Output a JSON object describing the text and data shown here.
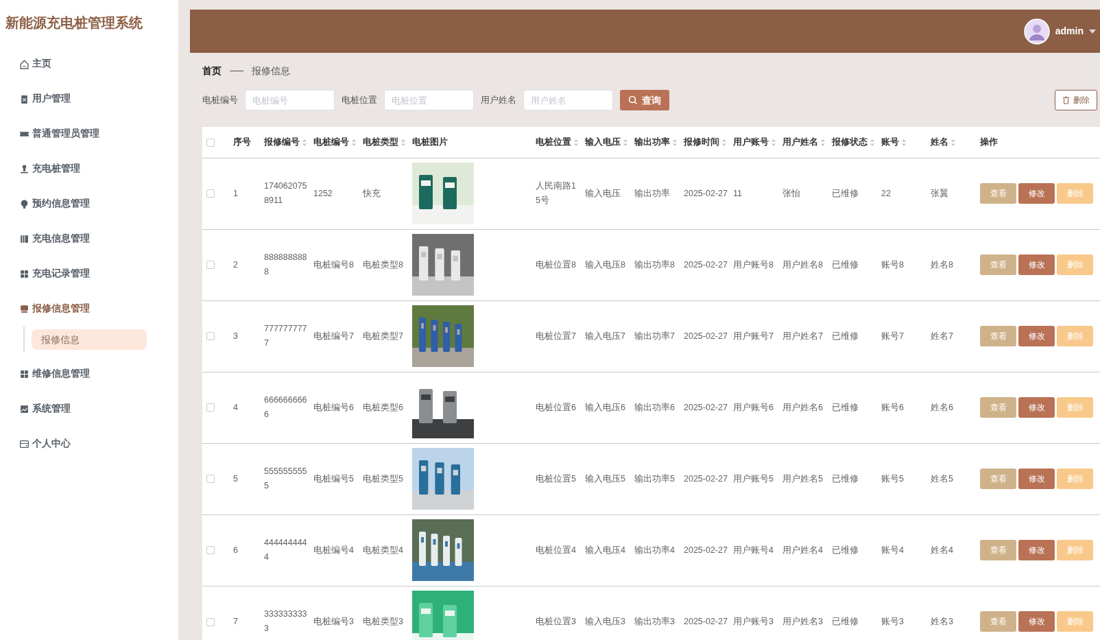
{
  "sidebar": {
    "title": "新能源充电桩管理系统",
    "items": [
      {
        "label": "主页",
        "selected": false
      },
      {
        "label": "用户管理",
        "selected": false
      },
      {
        "label": "普通管理员管理",
        "selected": false
      },
      {
        "label": "充电桩管理",
        "selected": false
      },
      {
        "label": "预约信息管理",
        "selected": false
      },
      {
        "label": "充电信息管理",
        "selected": false
      },
      {
        "label": "充电记录管理",
        "selected": false
      },
      {
        "label": "报修信息管理",
        "selected": true,
        "children": [
          {
            "label": "报修信息",
            "selected": true
          }
        ]
      },
      {
        "label": "维修信息管理",
        "selected": false
      },
      {
        "label": "系统管理",
        "selected": false
      },
      {
        "label": "个人中心",
        "selected": false
      }
    ]
  },
  "header": {
    "user": "admin"
  },
  "breadcrumb": [
    "首页",
    "报修信息"
  ],
  "search": {
    "fields": [
      {
        "label": "电桩编号",
        "placeholder": "电桩编号"
      },
      {
        "label": "电桩位置",
        "placeholder": "电桩位置"
      },
      {
        "label": "用户姓名",
        "placeholder": "用户姓名"
      }
    ],
    "button": "查询",
    "delete_button": "删除"
  },
  "table": {
    "header_checked": false,
    "columns": [
      {
        "label": "序号",
        "sortable": false
      },
      {
        "label": "报修编号",
        "sortable": true
      },
      {
        "label": "电桩编号",
        "sortable": true
      },
      {
        "label": "电桩类型",
        "sortable": true
      },
      {
        "label": "电桩图片",
        "sortable": false
      },
      {
        "label": "电桩位置",
        "sortable": true
      },
      {
        "label": "输入电压",
        "sortable": true
      },
      {
        "label": "输出功率",
        "sortable": true
      },
      {
        "label": "报修时间",
        "sortable": true
      },
      {
        "label": "用户账号",
        "sortable": true
      },
      {
        "label": "用户姓名",
        "sortable": true
      },
      {
        "label": "报修状态",
        "sortable": true
      },
      {
        "label": "账号",
        "sortable": true
      },
      {
        "label": "姓名",
        "sortable": true
      },
      {
        "label": "操作",
        "sortable": false
      }
    ],
    "rows": [
      {
        "checked": false,
        "cells": [
          "1",
          "1740620758911",
          "1252",
          "快充",
          {
            "kind": "picture"
          },
          "人民南路15号",
          "输入电压",
          "输出功率",
          "2025-02-27",
          "11",
          "张怡",
          "已维修",
          "22",
          "张翼"
        ],
        "actions": [
          "查看",
          "修改",
          "删除"
        ]
      },
      {
        "checked": false,
        "cells": [
          "2",
          "8888888888",
          "电桩编号8",
          "电桩类型8",
          {
            "kind": "picture"
          },
          "电桩位置8",
          "输入电压8",
          "输出功率8",
          "2025-02-27",
          "用户账号8",
          "用户姓名8",
          "已维修",
          "账号8",
          "姓名8"
        ],
        "actions": [
          "查看",
          "修改",
          "删除"
        ]
      },
      {
        "checked": false,
        "cells": [
          "3",
          "7777777777",
          "电桩编号7",
          "电桩类型7",
          {
            "kind": "picture"
          },
          "电桩位置7",
          "输入电压7",
          "输出功率7",
          "2025-02-27",
          "用户账号7",
          "用户姓名7",
          "已维修",
          "账号7",
          "姓名7"
        ],
        "actions": [
          "查看",
          "修改",
          "删除"
        ]
      },
      {
        "checked": false,
        "cells": [
          "4",
          "6666666666",
          "电桩编号6",
          "电桩类型6",
          {
            "kind": "picture"
          },
          "电桩位置6",
          "输入电压6",
          "输出功率6",
          "2025-02-27",
          "用户账号6",
          "用户姓名6",
          "已维修",
          "账号6",
          "姓名6"
        ],
        "actions": [
          "查看",
          "修改",
          "删除"
        ]
      },
      {
        "checked": false,
        "cells": [
          "5",
          "5555555555",
          "电桩编号5",
          "电桩类型5",
          {
            "kind": "picture"
          },
          "电桩位置5",
          "输入电压5",
          "输出功率5",
          "2025-02-27",
          "用户账号5",
          "用户姓名5",
          "已维修",
          "账号5",
          "姓名5"
        ],
        "actions": [
          "查看",
          "修改",
          "删除"
        ]
      },
      {
        "checked": false,
        "cells": [
          "6",
          "4444444444",
          "电桩编号4",
          "电桩类型4",
          {
            "kind": "picture"
          },
          "电桩位置4",
          "输入电压4",
          "输出功率4",
          "2025-02-27",
          "用户账号4",
          "用户姓名4",
          "已维修",
          "账号4",
          "姓名4"
        ],
        "actions": [
          "查看",
          "修改",
          "删除"
        ]
      },
      {
        "checked": false,
        "cells": [
          "7",
          "3333333333",
          "电桩编号3",
          "电桩类型3",
          {
            "kind": "picture"
          },
          "电桩位置3",
          "输入电压3",
          "输出功率3",
          "2025-02-27",
          "用户账号3",
          "用户姓名3",
          "已维修",
          "账号3",
          "姓名3"
        ],
        "actions": [
          "查看",
          "修改",
          "删除"
        ]
      }
    ]
  }
}
